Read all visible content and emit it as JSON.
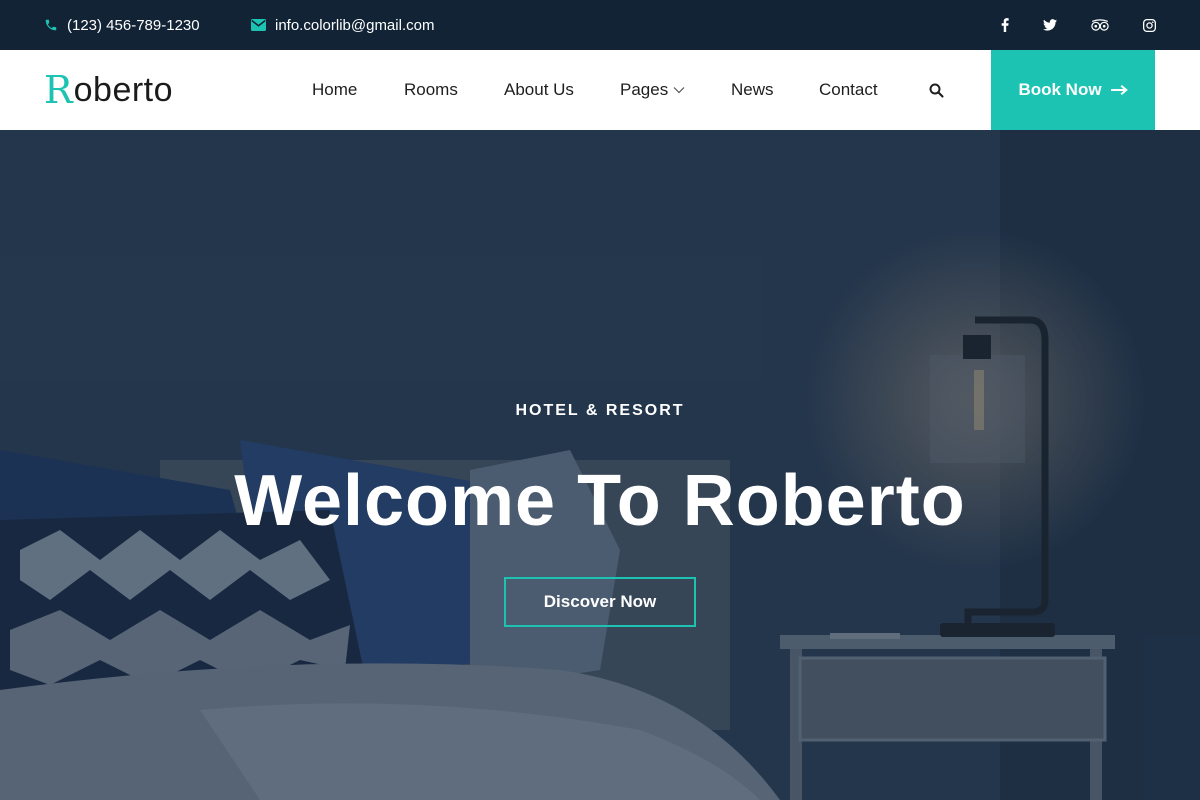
{
  "topbar": {
    "phone": "(123) 456-789-1230",
    "email": "info.colorlib@gmail.com",
    "social": [
      "facebook-icon",
      "twitter-icon",
      "tripadvisor-icon",
      "instagram-icon"
    ]
  },
  "brand": {
    "logo_initial": "R",
    "logo_rest": "oberto"
  },
  "nav": {
    "items": [
      "Home",
      "Rooms",
      "About Us",
      "Pages",
      "News",
      "Contact"
    ],
    "book_label": "Book Now"
  },
  "hero": {
    "eyebrow": "HOTEL & RESORT",
    "headline": "Welcome To Roberto",
    "cta": "Discover Now"
  },
  "colors": {
    "accent": "#1cc3b2",
    "topbar_bg": "#112335",
    "header_bg": "#ffffff"
  }
}
